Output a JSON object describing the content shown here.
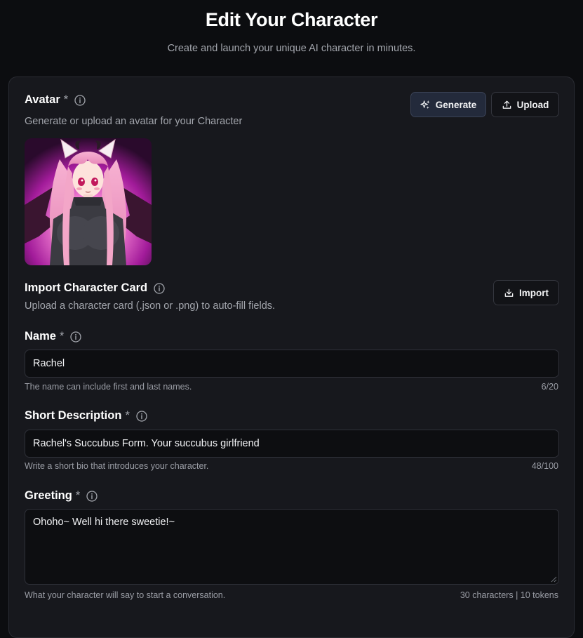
{
  "header": {
    "title": "Edit Your Character",
    "subtitle": "Create and launch your unique AI character in minutes."
  },
  "avatar": {
    "label": "Avatar",
    "required_mark": "*",
    "description": "Generate or upload an avatar for your Character",
    "generate_label": "Generate",
    "upload_label": "Upload"
  },
  "import_card": {
    "label": "Import Character Card",
    "description": "Upload a character card (.json or .png) to auto-fill fields.",
    "import_label": "Import"
  },
  "name": {
    "label": "Name",
    "required_mark": "*",
    "value": "Rachel",
    "hint": "The name can include first and last names.",
    "count": "6/20"
  },
  "short_description": {
    "label": "Short Description",
    "required_mark": "*",
    "value": "Rachel's Succubus Form. Your succubus girlfriend",
    "hint": "Write a short bio that introduces your character.",
    "count": "48/100"
  },
  "greeting": {
    "label": "Greeting",
    "required_mark": "*",
    "value": "Ohoho~ Well hi there sweetie!~",
    "hint": "What your character will say to start a conversation.",
    "count": "30 characters | 10 tokens"
  },
  "colors": {
    "background": "#0c0d10",
    "card": "#17181d",
    "accent_button": "#232a3b"
  },
  "icons": [
    "info-icon",
    "sparkles-icon",
    "upload-icon",
    "import-icon"
  ]
}
